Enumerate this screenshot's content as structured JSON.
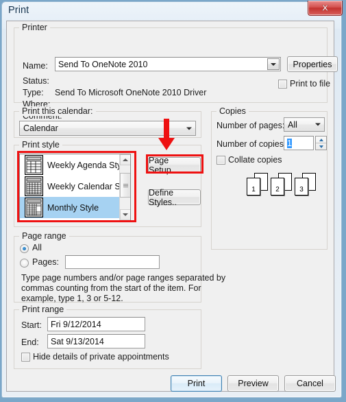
{
  "window": {
    "title": "Print",
    "close_icon": "close-x-icon"
  },
  "printer": {
    "legend": "Printer",
    "name_label": "Name:",
    "name_value": "Send To OneNote 2010",
    "properties_button": "Properties",
    "status_label": "Status:",
    "status_value": "",
    "type_label": "Type:",
    "type_value": "Send To Microsoft OneNote 2010 Driver",
    "where_label": "Where:",
    "where_value": "",
    "comment_label": "Comment:",
    "comment_value": "",
    "print_to_file_label": "Print to file",
    "print_to_file_checked": false
  },
  "print_this_calendar": {
    "legend": "Print this calendar:",
    "value": "Calendar"
  },
  "print_style": {
    "legend": "Print style",
    "items": [
      {
        "label": "Weekly Agenda Sty",
        "icon": "agenda-style-icon",
        "selected": false
      },
      {
        "label": "Weekly Calendar St",
        "icon": "weekly-calendar-style-icon",
        "selected": false
      },
      {
        "label": "Monthly Style",
        "icon": "monthly-style-icon",
        "selected": true
      }
    ],
    "page_setup_button": "Page Setup...",
    "define_styles_button": "Define Styles.."
  },
  "copies": {
    "legend": "Copies",
    "number_of_pages_label": "Number of pages:",
    "number_of_pages_value": "All",
    "number_of_copies_label": "Number of copies:",
    "number_of_copies_value": "1",
    "collate_label": "Collate copies",
    "collate_checked": false,
    "collate_preview_pages": [
      "1",
      "2",
      "3"
    ]
  },
  "page_range": {
    "legend": "Page range",
    "all_label": "All",
    "all_selected": true,
    "pages_label": "Pages:",
    "pages_value": "",
    "hint_line1": "Type page numbers and/or page ranges separated by",
    "hint_line2": "commas counting from the start of the item.  For",
    "hint_line3": "example, type 1, 3 or 5-12."
  },
  "print_range": {
    "legend": "Print range",
    "start_label": "Start:",
    "start_value": "Fri 9/12/2014",
    "end_label": "End:",
    "end_value": "Sat 9/13/2014",
    "hide_private_label": "Hide details of private appointments",
    "hide_private_checked": false
  },
  "footer": {
    "print_button": "Print",
    "preview_button": "Preview",
    "cancel_button": "Cancel"
  },
  "annotations": {
    "highlight_color": "#ee1111",
    "arrow_icon": "down-arrow-annotation",
    "targets": [
      "print-style-listbox",
      "page-setup-button"
    ]
  }
}
